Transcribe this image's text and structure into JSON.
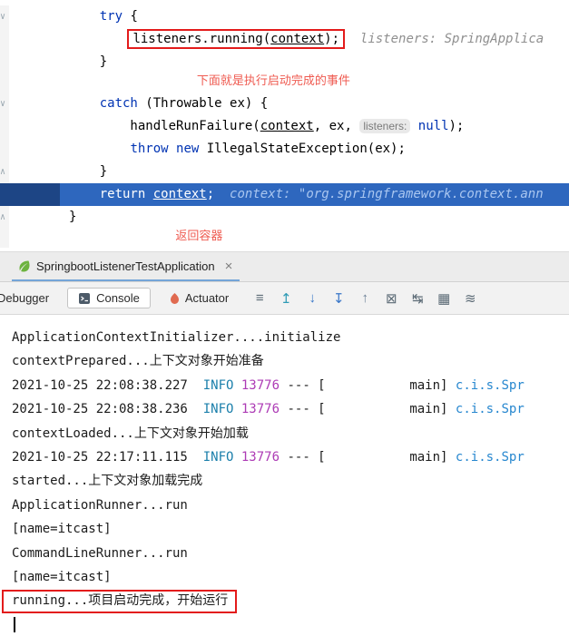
{
  "colors": {
    "keyword_blue": "#0033B3",
    "hint_gray": "#8F8F8F",
    "annotation_red": "#E31B1B",
    "annotation_text_red": "#EF5B51",
    "exec_line_blue": "#2E67BE",
    "exec_gutter_blue": "#1D4585",
    "info_teal": "#1B7FAB",
    "pid_magenta": "#AD3BB5",
    "logger_blue": "#2787CF",
    "spring_green": "#6DB33F",
    "actuator_orange": "#E06A50"
  },
  "editor": {
    "lines": [
      {
        "fold": "down",
        "segments": [
          {
            "t": "    "
          },
          {
            "t": "try",
            "c": "k"
          },
          {
            "t": " {"
          }
        ]
      },
      {
        "box": [
          1,
          3
        ],
        "segments": [
          {
            "t": "        "
          },
          {
            "t": "listeners.running("
          },
          {
            "t": "context",
            "c": "pu"
          },
          {
            "t": ");"
          },
          {
            "t": "  "
          },
          {
            "t": "listeners: SpringApplica",
            "c": "h"
          }
        ]
      },
      {
        "segments": [
          {
            "t": "    }"
          }
        ]
      },
      {
        "note": true,
        "segments": [
          {
            "t": "                  "
          },
          {
            "t": "下面就是执行启动完成的事件",
            "c": "r"
          }
        ]
      },
      {
        "fold": "down",
        "segments": [
          {
            "t": "    "
          },
          {
            "t": "catch",
            "c": "k"
          },
          {
            "t": " (Throwable ex) {"
          }
        ]
      },
      {
        "segments": [
          {
            "t": "        handleRunFailure("
          },
          {
            "t": "context",
            "c": "pu"
          },
          {
            "t": ", ex, "
          },
          {
            "t": "listeners:",
            "c": "chip"
          },
          {
            "t": " "
          },
          {
            "t": "null",
            "c": "k"
          },
          {
            "t": ");"
          }
        ]
      },
      {
        "segments": [
          {
            "t": "        "
          },
          {
            "t": "throw",
            "c": "k"
          },
          {
            "t": " "
          },
          {
            "t": "new",
            "c": "k"
          },
          {
            "t": " IllegalStateException(ex);"
          }
        ]
      },
      {
        "fold": "up",
        "segments": [
          {
            "t": "    }"
          }
        ]
      },
      {
        "highlight": true,
        "segments": [
          {
            "t": "    "
          },
          {
            "t": "return",
            "c": "k"
          },
          {
            "t": " "
          },
          {
            "t": "context",
            "c": "pu"
          },
          {
            "t": ";  "
          },
          {
            "t": "context: \"org.springframework.context.ann",
            "c": "h"
          }
        ]
      },
      {
        "fold": "up",
        "segments": [
          {
            "t": "}"
          }
        ]
      },
      {
        "note": true,
        "segments": [
          {
            "t": "               "
          },
          {
            "t": "返回容器",
            "c": "r"
          }
        ]
      }
    ]
  },
  "run_tab": {
    "title": "SpringbootListenerTestApplication",
    "close_glyph": "×"
  },
  "toolbar": {
    "debugger_label": "Debugger",
    "console_label": "Console",
    "actuator_label": "Actuator",
    "icons": [
      {
        "glyph": "≡",
        "name": "layout-settings-icon",
        "color": "#5C6B76"
      },
      {
        "glyph": "↥",
        "name": "up-the-stack-trace-icon",
        "color": "#2E9BB5"
      },
      {
        "glyph": "↓",
        "name": "down-the-stack-trace-icon",
        "color": "#3876C8"
      },
      {
        "glyph": "↧",
        "name": "scroll-to-end-icon",
        "color": "#3876C8"
      },
      {
        "glyph": "↑",
        "name": "scroll-to-top-icon",
        "color": "#6A7F95"
      },
      {
        "glyph": "⊠",
        "name": "clear-all-icon",
        "color": "#5C6B76"
      },
      {
        "glyph": "↹",
        "name": "jump-to-source-icon",
        "color": "#5C6B76"
      },
      {
        "glyph": "▦",
        "name": "restore-layout-icon",
        "color": "#5C6B76"
      },
      {
        "glyph": "≋",
        "name": "soft-wrap-icon",
        "color": "#5C6B76"
      }
    ]
  },
  "console": {
    "lines": [
      {
        "segments": [
          {
            "t": "ApplicationContextInitializer....initialize"
          }
        ]
      },
      {
        "segments": [
          {
            "t": "contextPrepared...上下文对象开始准备"
          }
        ]
      },
      {
        "segments": [
          {
            "t": "2021-10-25 22:08:38.227  "
          },
          {
            "t": "INFO",
            "c": "info"
          },
          {
            "t": " "
          },
          {
            "t": "13776",
            "c": "pid"
          },
          {
            "t": " --- ["
          },
          {
            "t": "           main] "
          },
          {
            "t": "c.i.s.Spr",
            "c": "logger"
          }
        ]
      },
      {
        "segments": [
          {
            "t": "2021-10-25 22:08:38.236  "
          },
          {
            "t": "INFO",
            "c": "info"
          },
          {
            "t": " "
          },
          {
            "t": "13776",
            "c": "pid"
          },
          {
            "t": " --- ["
          },
          {
            "t": "           main] "
          },
          {
            "t": "c.i.s.Spr",
            "c": "logger"
          }
        ]
      },
      {
        "segments": [
          {
            "t": "contextLoaded...上下文对象开始加载"
          }
        ]
      },
      {
        "segments": [
          {
            "t": "2021-10-25 22:17:11.115  "
          },
          {
            "t": "INFO",
            "c": "info"
          },
          {
            "t": " "
          },
          {
            "t": "13776",
            "c": "pid"
          },
          {
            "t": " --- ["
          },
          {
            "t": "           main] "
          },
          {
            "t": "c.i.s.Spr",
            "c": "logger"
          }
        ]
      },
      {
        "segments": [
          {
            "t": "started...上下文对象加载完成"
          }
        ]
      },
      {
        "segments": [
          {
            "t": "ApplicationRunner...run"
          }
        ]
      },
      {
        "segments": [
          {
            "t": "[name=itcast]"
          }
        ]
      },
      {
        "segments": [
          {
            "t": "CommandLineRunner...run"
          }
        ]
      },
      {
        "segments": [
          {
            "t": "[name=itcast]"
          }
        ]
      },
      {
        "box": true,
        "segments": [
          {
            "t": "running...项目启动完成，开始运行"
          }
        ]
      },
      {
        "caret": true,
        "segments": []
      }
    ]
  }
}
